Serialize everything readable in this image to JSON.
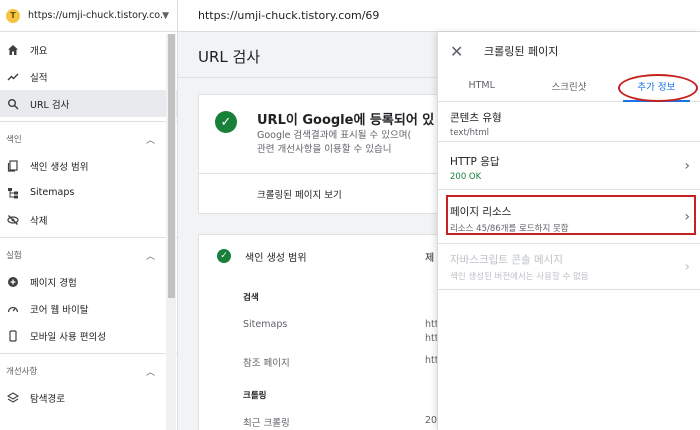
{
  "sidebar": {
    "property": "https://umji-chuck.tistory.co...",
    "nav_top": [
      {
        "label": "개요",
        "icon": "home-icon"
      },
      {
        "label": "실적",
        "icon": "trend-icon"
      },
      {
        "label": "URL 검사",
        "icon": "search-icon"
      }
    ],
    "section_index": "색인",
    "nav_index": [
      {
        "label": "색인 생성 범위",
        "icon": "pages-icon"
      },
      {
        "label": "Sitemaps",
        "icon": "sitemap-icon"
      },
      {
        "label": "삭제",
        "icon": "eye-off-icon"
      }
    ],
    "section_experience": "실험",
    "nav_experience": [
      {
        "label": "페이지 경험",
        "icon": "plus-circle-icon"
      },
      {
        "label": "코어 웹 바이탈",
        "icon": "gauge-icon"
      },
      {
        "label": "모바일 사용 편의성",
        "icon": "phone-icon"
      }
    ],
    "section_enhancements": "개선사항",
    "nav_enhancements": [
      {
        "label": "탐색경로",
        "icon": "layers-icon"
      }
    ]
  },
  "topbar": {
    "url": "https://umji-chuck.tistory.com/69"
  },
  "main": {
    "title": "URL 검사",
    "status_headline": "URL이 Google에 등록되어 있",
    "status_sub1": "Google 검색결과에 표시될 수 있으며(",
    "status_sub2": "관련 개선사항을 이용할 수 있습니",
    "view_crawled": "크롤링된 페이지 보기",
    "coverage_title": "색인 생성 범위",
    "coverage_right": "제",
    "rows": [
      {
        "label": "검색",
        "value": ""
      },
      {
        "label": "Sitemaps",
        "value": "htt"
      },
      {
        "label": "",
        "value": "htt"
      },
      {
        "label": "참조 페이지",
        "value": "htt"
      },
      {
        "label": "크롤링",
        "value": ""
      },
      {
        "label": "최근 크롤링",
        "value": "20"
      }
    ]
  },
  "panel": {
    "title": "크롤링된 페이지",
    "tabs": [
      "HTML",
      "스크린샷",
      "추가 정보"
    ],
    "items": [
      {
        "title": "콘텐츠 유형",
        "sub": "text/html"
      },
      {
        "title": "HTTP 응답",
        "sub": "200 OK"
      },
      {
        "title": "페이지 리소스",
        "sub": "리소스 45/86개를 로드하지 못함"
      },
      {
        "title": "자바스크립트 콘솔 메시지",
        "sub": "색인 생성된 버전에서는 사용할 수 없음"
      }
    ]
  },
  "colors": {
    "accent": "#1a73e8",
    "success": "#188038",
    "annotation": "#c5221f"
  }
}
